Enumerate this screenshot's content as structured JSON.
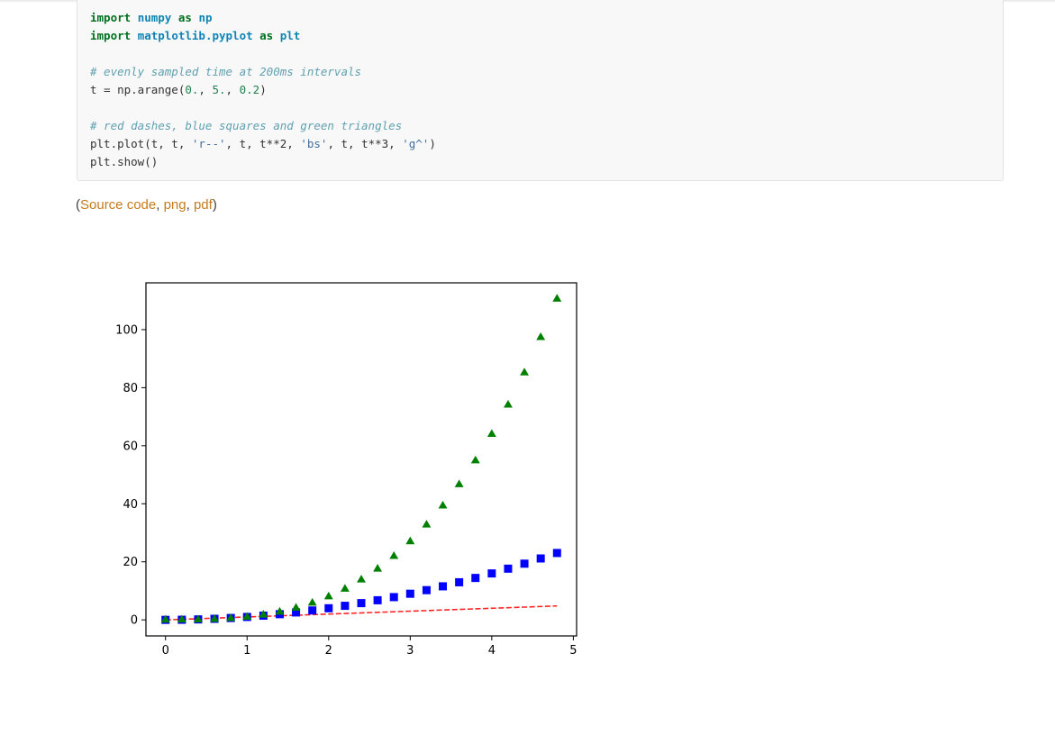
{
  "code": {
    "line1": {
      "kw1": "import",
      "mod": "numpy",
      "kw2": "as",
      "alias": "np"
    },
    "line2": {
      "kw1": "import",
      "mod": "matplotlib.pyplot",
      "kw2": "as",
      "alias": "plt"
    },
    "line3": {
      "comment": "# evenly sampled time at 200ms intervals"
    },
    "line4": {
      "pre": "t = np.arange(",
      "a": "0.",
      "c1": ", ",
      "b": "5.",
      "c2": ", ",
      "c": "0.2",
      "post": ")"
    },
    "line5": {
      "comment": "# red dashes, blue squares and green triangles"
    },
    "line6": {
      "pre": "plt.plot(t, t, ",
      "s1": "'r--'",
      "mid1": ", t, t**2, ",
      "s2": "'bs'",
      "mid2": ", t, t**3, ",
      "s3": "'g^'",
      "post": ")"
    },
    "line7": {
      "text": "plt.show()"
    }
  },
  "source": {
    "open": "(",
    "source_code": "Source code",
    "sep1": ", ",
    "png": "png",
    "sep2": ", ",
    "pdf": "pdf",
    "close": ")"
  },
  "colors": {
    "link": "#c67b1d",
    "red": "#ff0000",
    "blue": "#0000ff",
    "green": "#008000"
  },
  "chart_data": {
    "type": "line",
    "title": "",
    "xlabel": "",
    "ylabel": "",
    "x": [
      0,
      0.2,
      0.4,
      0.6,
      0.8,
      1.0,
      1.2,
      1.4,
      1.6,
      1.8,
      2.0,
      2.2,
      2.4,
      2.6,
      2.8,
      3.0,
      3.2,
      3.4,
      3.6,
      3.8,
      4.0,
      4.2,
      4.4,
      4.6,
      4.8
    ],
    "series": [
      {
        "style": "red dashes",
        "color": "#ff0000",
        "marker": "none",
        "linestyle": "dashed",
        "values": [
          0,
          0.2,
          0.4,
          0.6,
          0.8,
          1.0,
          1.2,
          1.4,
          1.6,
          1.8,
          2.0,
          2.2,
          2.4,
          2.6,
          2.8,
          3.0,
          3.2,
          3.4,
          3.6,
          3.8,
          4.0,
          4.2,
          4.4,
          4.6,
          4.8
        ]
      },
      {
        "style": "blue squares",
        "color": "#0000ff",
        "marker": "square",
        "linestyle": "none",
        "values": [
          0,
          0.04,
          0.16,
          0.36,
          0.64,
          1.0,
          1.44,
          1.96,
          2.56,
          3.24,
          4.0,
          4.84,
          5.76,
          6.76,
          7.84,
          9.0,
          10.24,
          11.56,
          12.96,
          14.44,
          16.0,
          17.64,
          19.36,
          21.16,
          23.04
        ]
      },
      {
        "style": "green triangles",
        "color": "#008000",
        "marker": "triangle-up",
        "linestyle": "none",
        "values": [
          0,
          0.008,
          0.064,
          0.216,
          0.512,
          1.0,
          1.728,
          2.744,
          4.096,
          5.832,
          8.0,
          10.648,
          13.824,
          17.576,
          21.952,
          27.0,
          32.768,
          39.304,
          46.656,
          54.872,
          64.0,
          74.088,
          85.184,
          97.336,
          110.592
        ]
      }
    ],
    "xlim": [
      -0.24,
      5.04
    ],
    "ylim": [
      -5.53,
      116.12
    ],
    "xticks": [
      "0",
      "1",
      "2",
      "3",
      "4",
      "5"
    ],
    "yticks": [
      "0",
      "20",
      "40",
      "60",
      "80",
      "100"
    ],
    "grid": false,
    "legend": "none"
  }
}
